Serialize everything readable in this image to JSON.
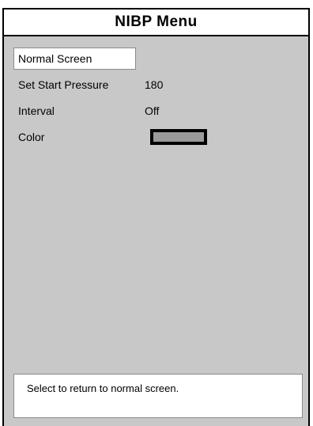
{
  "window": {
    "title": "NIBP Menu"
  },
  "menu": {
    "normal_screen_label": "Normal Screen",
    "items": [
      {
        "label": "Set Start Pressure",
        "value": "180"
      },
      {
        "label": "Interval",
        "value": "Off"
      },
      {
        "label": "Color",
        "swatch_color": "#9a9a9a"
      }
    ]
  },
  "status": {
    "help_text": "Select to return to normal screen."
  }
}
